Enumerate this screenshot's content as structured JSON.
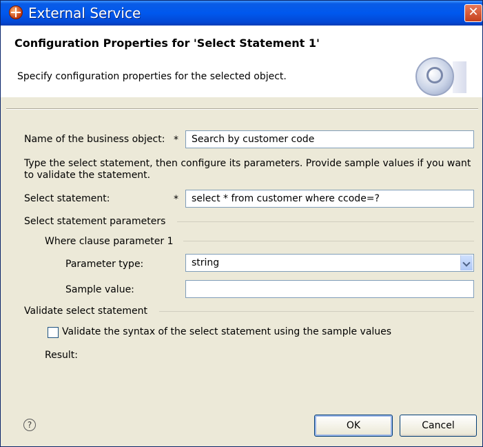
{
  "window": {
    "title": "External Service",
    "close_glyph": "✕"
  },
  "header": {
    "title": "Configuration Properties for 'Select Statement 1'",
    "description": "Specify configuration properties for the selected object."
  },
  "form": {
    "bo_name": {
      "label": "Name of the business object:",
      "required_marker": "*",
      "value": "Search by customer code"
    },
    "instructions": "Type the select statement, then configure its parameters. Provide sample values if you want to validate the statement.",
    "select_statement": {
      "label": "Select statement:",
      "required_marker": "*",
      "value": "select * from customer where ccode=?"
    },
    "params_group": {
      "title": "Select statement parameters",
      "where_clause": {
        "title": "Where clause parameter 1",
        "param_type": {
          "label": "Parameter type:",
          "value": "string"
        },
        "sample_value": {
          "label": "Sample value:",
          "value": ""
        }
      }
    },
    "validate_group": {
      "title": "Validate select statement",
      "checkbox_label": "Validate the syntax of the select statement using the sample values",
      "checked": false,
      "result_label": "Result:"
    }
  },
  "footer": {
    "help_glyph": "?",
    "ok_label": "OK",
    "cancel_label": "Cancel"
  },
  "icons": {
    "app": "external-service-icon",
    "wizard": "wizard-banner-icon",
    "help": "help-icon",
    "dropdown": "chevron-down-icon"
  },
  "colors": {
    "titlebar": "#0058ee",
    "dialog_bg": "#ece9d8",
    "input_border": "#7f9db9",
    "close": "#c5401c"
  }
}
